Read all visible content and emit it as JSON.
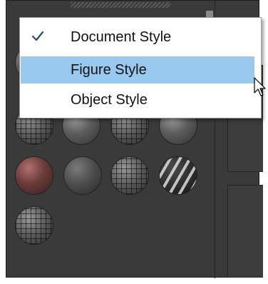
{
  "menu": {
    "items": [
      {
        "label": "Document Style",
        "checked": true
      },
      {
        "label": "Figure Style",
        "highlighted": true
      },
      {
        "label": "Object Style"
      }
    ]
  },
  "colors": {
    "panel_bg": "#3a3a3a",
    "menu_bg": "#ffffff",
    "highlight": "#99c9ef",
    "check_mark": "#2b4a74"
  },
  "icons": {
    "check": "checkmark-icon",
    "cursor": "mouse-pointer-icon"
  }
}
